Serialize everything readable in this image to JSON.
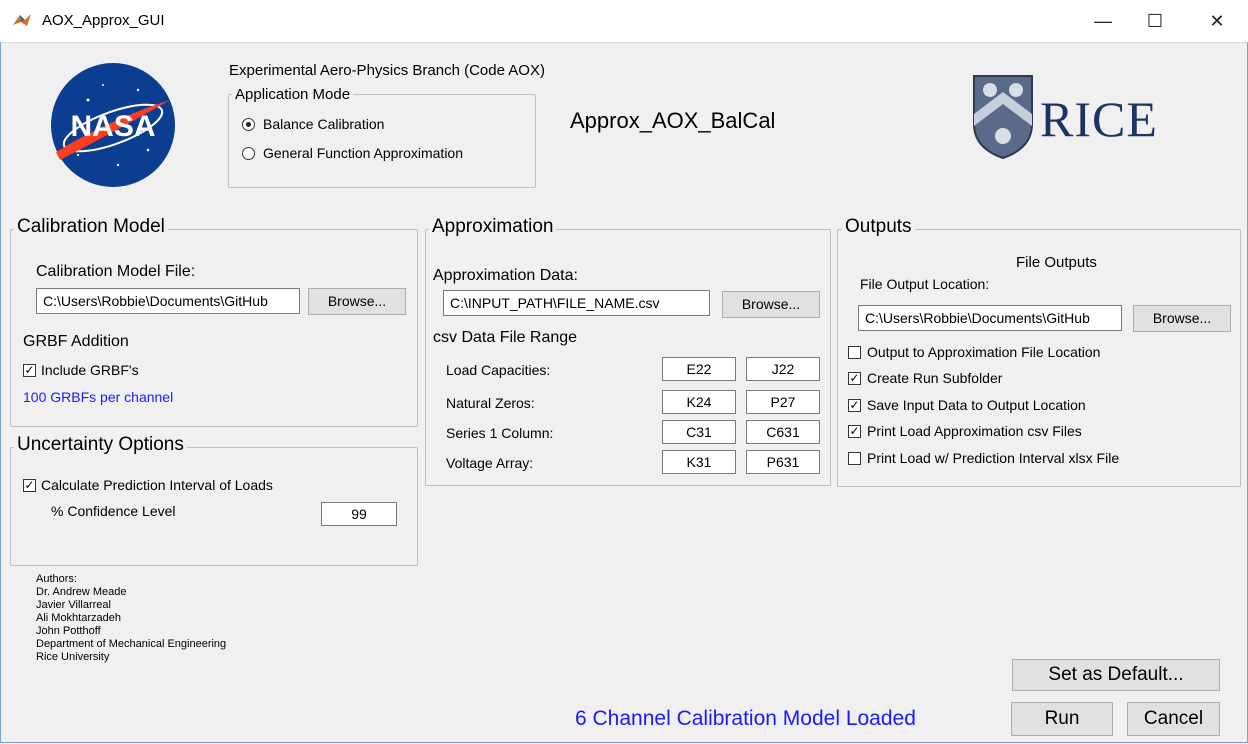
{
  "window": {
    "title": "AOX_Approx_GUI",
    "minimize": "—",
    "maximize": "☐",
    "close": "✕"
  },
  "header": {
    "branch": "Experimental Aero-Physics Branch (Code AOX)",
    "app_title": "Approx_AOX_BalCal",
    "nasa_logo_text": "NASA",
    "rice_logo_text": "RICE"
  },
  "application_mode": {
    "title": "Application Mode",
    "options": [
      "Balance Calibration",
      "General Function Approximation"
    ],
    "selected": 0
  },
  "calibration_model": {
    "title": "Calibration Model",
    "file_label": "Calibration Model File:",
    "file_value": "C:\\Users\\Robbie\\Documents\\GitHub",
    "browse": "Browse...",
    "grbf_title": "GRBF Addition",
    "include_grbf": "Include GRBF's",
    "include_grbf_checked": true,
    "grbf_info": "100 GRBFs per channel"
  },
  "uncertainty": {
    "title": "Uncertainty Options",
    "calc_pi": "Calculate Prediction Interval of Loads",
    "calc_pi_checked": true,
    "confidence_label": "% Confidence Level",
    "confidence_value": "99"
  },
  "approximation": {
    "title": "Approximation",
    "data_label": "Approximation Data:",
    "data_value": "C:\\INPUT_PATH\\FILE_NAME.csv",
    "browse": "Browse...",
    "range_title": "csv Data File Range",
    "rows": [
      {
        "label": "Load Capacities:",
        "start": "E22",
        "end": "J22"
      },
      {
        "label": "Natural Zeros:",
        "start": "K24",
        "end": "P27"
      },
      {
        "label": "Series 1 Column:",
        "start": "C31",
        "end": "C631"
      },
      {
        "label": "Voltage Array:",
        "start": "K31",
        "end": "P631"
      }
    ]
  },
  "outputs": {
    "title": "Outputs",
    "file_outputs_title": "File Outputs",
    "location_label": "File Output Location:",
    "location_value": "C:\\Users\\Robbie\\Documents\\GitHub",
    "browse": "Browse...",
    "checks": [
      {
        "label": "Output to Approximation File Location",
        "checked": false
      },
      {
        "label": "Create Run Subfolder",
        "checked": true
      },
      {
        "label": "Save Input Data to Output Location",
        "checked": true
      },
      {
        "label": "Print Load Approximation csv Files",
        "checked": true
      },
      {
        "label": "Print Load w/ Prediction Interval xlsx File",
        "checked": false
      }
    ]
  },
  "authors": [
    "Authors:",
    "Dr. Andrew Meade",
    "Javier Villarreal",
    "Ali Mokhtarzadeh",
    "John Potthoff",
    "Department of Mechanical Engineering",
    "Rice University"
  ],
  "footer": {
    "status": "6 Channel Calibration Model Loaded",
    "status_color": "#1a1aff",
    "set_default": "Set as Default...",
    "run": "Run",
    "cancel": "Cancel"
  }
}
